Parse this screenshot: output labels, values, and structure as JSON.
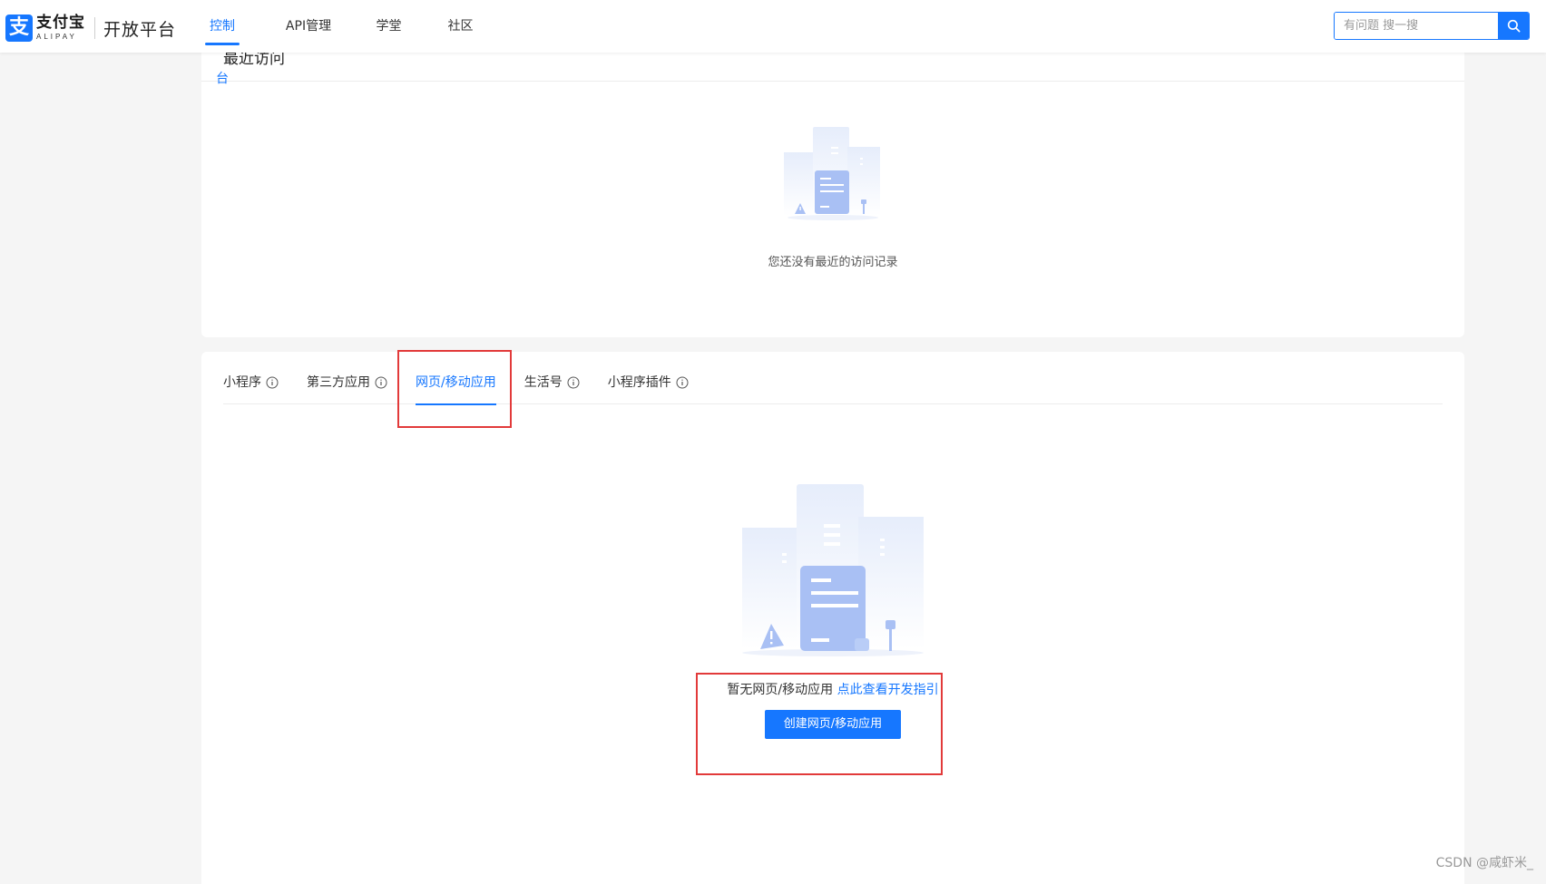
{
  "header": {
    "logo": {
      "mark": "支",
      "brand_cn": "支付宝",
      "brand_en": "ALIPAY",
      "platform": "开放平台"
    },
    "nav": [
      {
        "label": "控制台",
        "active": true
      },
      {
        "label": "API管理",
        "active": false
      },
      {
        "label": "学堂",
        "active": false
      },
      {
        "label": "社区",
        "active": false
      }
    ],
    "search": {
      "placeholder": "有问题 搜一搜",
      "icon": "search-icon"
    }
  },
  "recent": {
    "title": "最近访问",
    "empty_text": "您还没有最近的访问记录"
  },
  "apps": {
    "tabs": [
      {
        "label": "小程序",
        "has_info": true,
        "active": false
      },
      {
        "label": "第三方应用",
        "has_info": true,
        "active": false
      },
      {
        "label": "网页/移动应用",
        "has_info": false,
        "active": true
      },
      {
        "label": "生活号",
        "has_info": true,
        "active": false
      },
      {
        "label": "小程序插件",
        "has_info": true,
        "active": false
      }
    ],
    "empty_text": "暂无网页/移动应用",
    "guide_link": "点此查看开发指引",
    "create_button": "创建网页/移动应用"
  },
  "watermark": "CSDN @咸虾米_",
  "colors": {
    "accent": "#1677ff",
    "highlight": "#e23a3a",
    "page_bg": "#f5f5f5"
  }
}
